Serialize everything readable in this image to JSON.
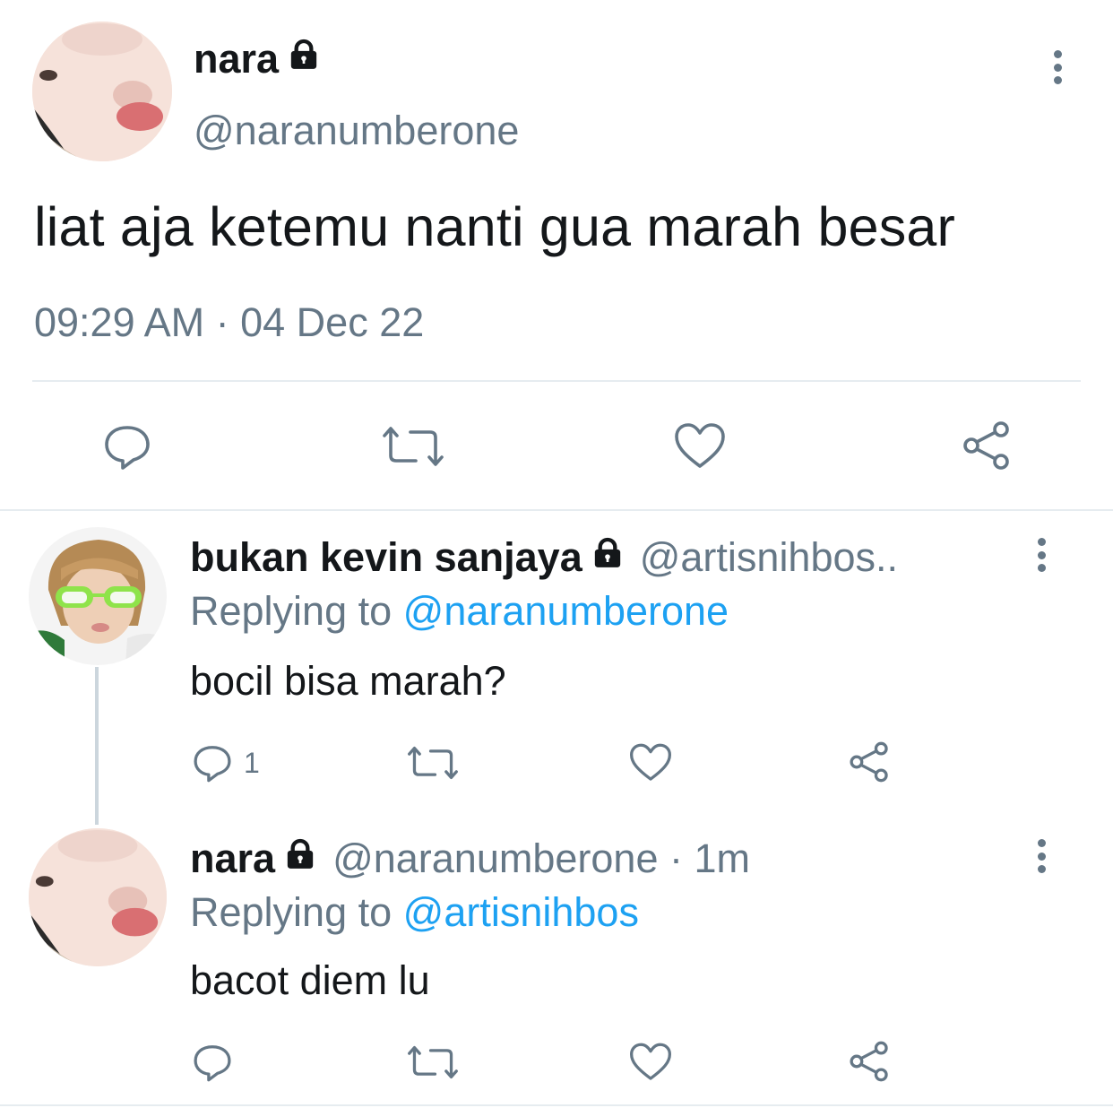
{
  "main_tweet": {
    "name": "nara",
    "handle": "@naranumberone",
    "text": "liat aja ketemu nanti gua marah besar",
    "timestamp": "09:29 AM · 04 Dec 22",
    "actions": [
      "reply-icon",
      "retweet-icon",
      "like-icon",
      "share-icon"
    ]
  },
  "replies": [
    {
      "name": "bukan kevin sanjaya",
      "handle": "@artisnihbos..",
      "replying_prefix": "Replying to",
      "replying_to": "@naranumberone",
      "text": "bocil bisa marah?",
      "reply_count": "1"
    },
    {
      "name": "nara",
      "handle": "@naranumberone · 1m",
      "replying_prefix": "Replying to",
      "replying_to": "@artisnihbos",
      "text": "bacot diem lu",
      "reply_count": ""
    }
  ],
  "colors": {
    "text_primary": "#14171a",
    "text_secondary": "#657786",
    "link": "#1da1f2",
    "divider": "#e6ecf0",
    "thread_line": "#ccd6dd"
  }
}
